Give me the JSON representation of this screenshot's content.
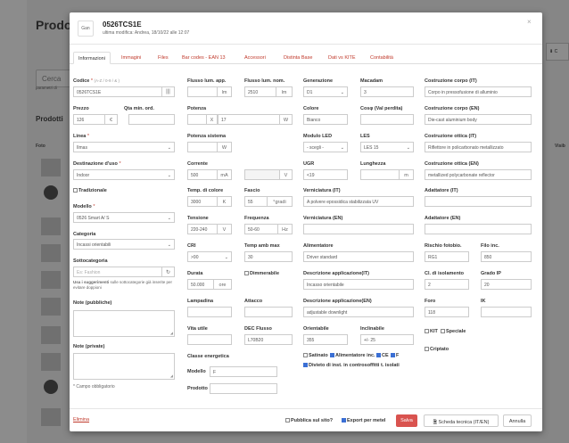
{
  "background": {
    "title": "Prodo",
    "search_placeholder": "Cerca",
    "params_text": "parametri di",
    "products_label": "Prodotti",
    "col_foto": "Foto",
    "col_visi": "Visib",
    "right_button": "⬇ C"
  },
  "modal": {
    "product_code": "0526TCS1E",
    "last_modified": "ultima modifica: Andrea, 18/10/22 alle 12:07",
    "logo_text": "Gan",
    "close": "×"
  },
  "tabs": [
    "Informazioni",
    "Immagini",
    "Files",
    "Bar codes - EAN 13",
    "Accessori",
    "Distinta Base",
    "Dati vs KITE",
    "Contabilità"
  ],
  "col1": {
    "codice_label": "Codice",
    "codice_req": "*",
    "codice_hint": "(A-Z / 0-9 / & )",
    "codice_value": "0526TCS1E",
    "barcode_icon": "|||",
    "prezzo_label": "Prezzo",
    "prezzo_value": "126",
    "prezzo_unit": "€",
    "qta_label": "Qta min. ord.",
    "linea_label": "Linea",
    "linea_req": "*",
    "linea_value": "Ilmas",
    "dest_label": "Destinazione d'uso",
    "dest_req": "*",
    "dest_value": "Indoor",
    "tradizionale": "Tradizionale",
    "modello_label": "Modello",
    "modello_req": "*",
    "modello_value": "0526 Smart A/ S",
    "categoria_label": "Categoria",
    "categoria_value": "Incassi orientabili",
    "sottocat_label": "Sottocategoria",
    "sottocat_placeholder": "Es: Fashion",
    "sottocat_icon": "↻",
    "sottocat_note_bold": "Usa i suggerimenti",
    "sottocat_note_rest": " sulle sottocategorie già inserite per evitare doppioni",
    "note_pub_label": "Note (pubbliche)",
    "note_priv_label": "Note (private)",
    "required_note": "* Campo obbligatorio"
  },
  "col2": {
    "flusso_app_label": "Flusso lum. app.",
    "flusso_app_unit": "lm",
    "potenza_label": "Potenza",
    "potenza_x": "X",
    "potenza_value": "17",
    "potenza_unit": "W",
    "potenza_sis_label": "Potenza sistema",
    "potenza_sis_unit": "W",
    "corrente_label": "Corrente",
    "corrente_value": "500",
    "corrente_unit": "mA",
    "corrente_v_unit": "V",
    "temp_label": "Temp. di colore",
    "temp_value": "3000",
    "temp_unit": "K",
    "tensione_label": "Tensione",
    "tensione_value": "220-240",
    "tensione_unit": "V",
    "cri_label": "CRI",
    "cri_value": ">90",
    "durata_label": "Durata",
    "durata_value": "50.000",
    "durata_unit": "ore",
    "lampadina_label": "Lampadina",
    "vita_label": "Vita utile",
    "classe_label": "Classe energetica",
    "modello_label": "Modello",
    "modello_value": "F",
    "prodotto_label": "Prodotto"
  },
  "col3": {
    "flusso_nom_label": "Flusso lum. nom.",
    "flusso_nom_value": "2510",
    "flusso_nom_unit": "lm",
    "fascio_label": "Fascio",
    "fascio_value": "55",
    "fascio_unit": "°gradi",
    "frequenza_label": "Frequenza",
    "frequenza_value": "50-60",
    "frequenza_unit": "Hz",
    "temp_amb_label": "Temp amb max",
    "temp_amb_value": "30",
    "dimmerabile": "Dimmerabile",
    "attacco_label": "Attacco",
    "dec_label": "DEC Flusso",
    "dec_value": "L70B20"
  },
  "col4": {
    "generazione_label": "Generazione",
    "generazione_value": "D1",
    "macadam_label": "Macadam",
    "macadam_value": "3",
    "colore_label": "Colore",
    "colore_value": "Bianco",
    "cosp_label": "Cosφ (Val perdita)",
    "modulo_label": "Modulo LED",
    "modulo_value": "- scegli -",
    "les_label": "LES",
    "les_value": "LES 15",
    "ugr_label": "UGR",
    "ugr_value": "<19",
    "lunghezza_label": "Lunghezza",
    "lunghezza_unit": "m",
    "vern_it_label": "Verniciatura (IT)",
    "vern_it_value": "A polvere epossidica stabilizzata UV",
    "vern_en_label": "Verniciatura (EN)",
    "alim_label": "Alimentatore",
    "alim_value": "Driver standard",
    "desc_it_label": "Descrizione applicazione(IT)",
    "desc_it_value": "Incasso orientabile",
    "desc_en_label": "Descrizione applicazione(EN)",
    "desc_en_value": "adjustable downlight",
    "orient_label": "Orientabile",
    "orient_value": "355",
    "incl_label": "Inclinabile",
    "incl_value": "+/- 25",
    "satinato": "Satinato",
    "alim_inc": "Alimentatore inc.",
    "ce": "CE",
    "f": "F",
    "divieto": "Divieto di inst. in controsoffitti t. isolati"
  },
  "col5": {
    "cc_it_label": "Costruzione corpo (IT)",
    "cc_it_value": "Corpo in pressofusione di alluminio",
    "cc_en_label": "Costruzione corpo (EN)",
    "cc_en_value": "Die-cast aluminium body",
    "co_it_label": "Costruzione ottica (IT)",
    "co_it_value": "Riflettore in policarbonato metallizzato",
    "co_en_label": "Costruzione ottica (EN)",
    "co_en_value": "metallized polycarbonate reflector",
    "adatt_it_label": "Adattatore (IT)",
    "adatt_en_label": "Adattatore (EN)",
    "rischio_label": "Rischio fotobio.",
    "rischio_value": "RG1",
    "filo_label": "Filo inc.",
    "filo_value": "850",
    "cl_iso_label": "Cl. di isolamento",
    "cl_iso_value": "2",
    "grado_label": "Grado IP",
    "grado_value": "20",
    "foro_label": "Foro",
    "foro_value": "118",
    "ik_label": "IK",
    "kit": "KIT",
    "speciale": "Speciale",
    "criptato": "Criptato"
  },
  "footer": {
    "elimina": "Elimina",
    "pubblica": "Pubblica sul sito?",
    "export": "Export per metel",
    "salva": "Salva",
    "scheda": "Scheda tecnica (IT/EN)",
    "annulla": "Annulla"
  },
  "colors": {
    "accent": "#d9534f",
    "link": "#c0392b",
    "check": "#3b6fd4"
  }
}
